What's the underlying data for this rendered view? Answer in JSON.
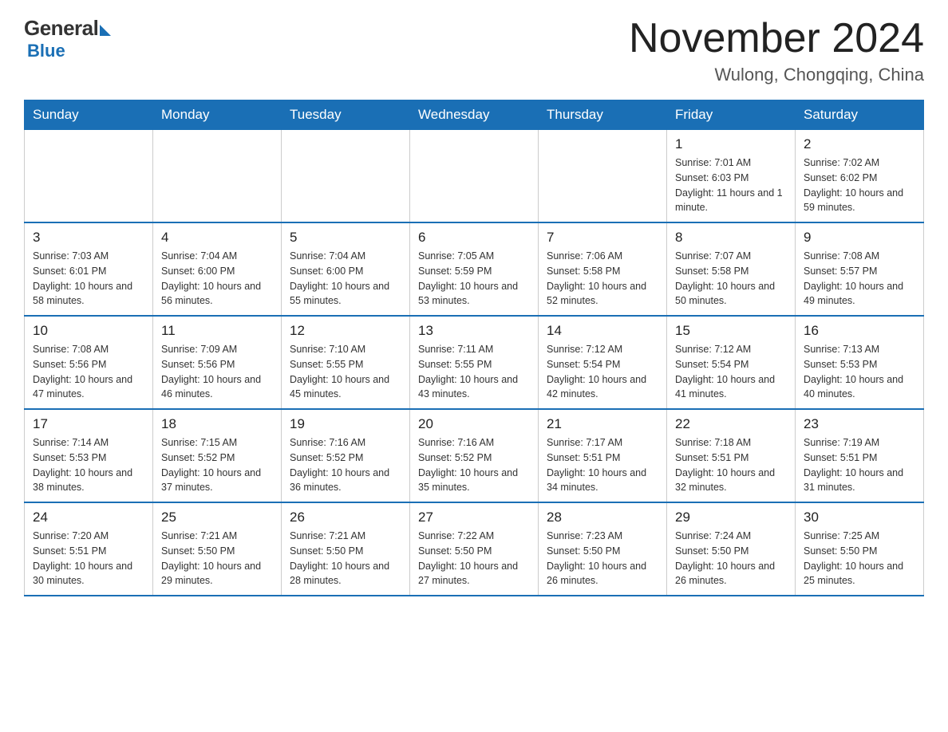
{
  "logo": {
    "general": "General",
    "blue": "Blue",
    "arrow_color": "#1a6fb5"
  },
  "header": {
    "title": "November 2024",
    "subtitle": "Wulong, Chongqing, China"
  },
  "weekdays": [
    "Sunday",
    "Monday",
    "Tuesday",
    "Wednesday",
    "Thursday",
    "Friday",
    "Saturday"
  ],
  "weeks": [
    [
      {
        "day": "",
        "info": ""
      },
      {
        "day": "",
        "info": ""
      },
      {
        "day": "",
        "info": ""
      },
      {
        "day": "",
        "info": ""
      },
      {
        "day": "",
        "info": ""
      },
      {
        "day": "1",
        "info": "Sunrise: 7:01 AM\nSunset: 6:03 PM\nDaylight: 11 hours\nand 1 minute."
      },
      {
        "day": "2",
        "info": "Sunrise: 7:02 AM\nSunset: 6:02 PM\nDaylight: 10 hours\nand 59 minutes."
      }
    ],
    [
      {
        "day": "3",
        "info": "Sunrise: 7:03 AM\nSunset: 6:01 PM\nDaylight: 10 hours\nand 58 minutes."
      },
      {
        "day": "4",
        "info": "Sunrise: 7:04 AM\nSunset: 6:00 PM\nDaylight: 10 hours\nand 56 minutes."
      },
      {
        "day": "5",
        "info": "Sunrise: 7:04 AM\nSunset: 6:00 PM\nDaylight: 10 hours\nand 55 minutes."
      },
      {
        "day": "6",
        "info": "Sunrise: 7:05 AM\nSunset: 5:59 PM\nDaylight: 10 hours\nand 53 minutes."
      },
      {
        "day": "7",
        "info": "Sunrise: 7:06 AM\nSunset: 5:58 PM\nDaylight: 10 hours\nand 52 minutes."
      },
      {
        "day": "8",
        "info": "Sunrise: 7:07 AM\nSunset: 5:58 PM\nDaylight: 10 hours\nand 50 minutes."
      },
      {
        "day": "9",
        "info": "Sunrise: 7:08 AM\nSunset: 5:57 PM\nDaylight: 10 hours\nand 49 minutes."
      }
    ],
    [
      {
        "day": "10",
        "info": "Sunrise: 7:08 AM\nSunset: 5:56 PM\nDaylight: 10 hours\nand 47 minutes."
      },
      {
        "day": "11",
        "info": "Sunrise: 7:09 AM\nSunset: 5:56 PM\nDaylight: 10 hours\nand 46 minutes."
      },
      {
        "day": "12",
        "info": "Sunrise: 7:10 AM\nSunset: 5:55 PM\nDaylight: 10 hours\nand 45 minutes."
      },
      {
        "day": "13",
        "info": "Sunrise: 7:11 AM\nSunset: 5:55 PM\nDaylight: 10 hours\nand 43 minutes."
      },
      {
        "day": "14",
        "info": "Sunrise: 7:12 AM\nSunset: 5:54 PM\nDaylight: 10 hours\nand 42 minutes."
      },
      {
        "day": "15",
        "info": "Sunrise: 7:12 AM\nSunset: 5:54 PM\nDaylight: 10 hours\nand 41 minutes."
      },
      {
        "day": "16",
        "info": "Sunrise: 7:13 AM\nSunset: 5:53 PM\nDaylight: 10 hours\nand 40 minutes."
      }
    ],
    [
      {
        "day": "17",
        "info": "Sunrise: 7:14 AM\nSunset: 5:53 PM\nDaylight: 10 hours\nand 38 minutes."
      },
      {
        "day": "18",
        "info": "Sunrise: 7:15 AM\nSunset: 5:52 PM\nDaylight: 10 hours\nand 37 minutes."
      },
      {
        "day": "19",
        "info": "Sunrise: 7:16 AM\nSunset: 5:52 PM\nDaylight: 10 hours\nand 36 minutes."
      },
      {
        "day": "20",
        "info": "Sunrise: 7:16 AM\nSunset: 5:52 PM\nDaylight: 10 hours\nand 35 minutes."
      },
      {
        "day": "21",
        "info": "Sunrise: 7:17 AM\nSunset: 5:51 PM\nDaylight: 10 hours\nand 34 minutes."
      },
      {
        "day": "22",
        "info": "Sunrise: 7:18 AM\nSunset: 5:51 PM\nDaylight: 10 hours\nand 32 minutes."
      },
      {
        "day": "23",
        "info": "Sunrise: 7:19 AM\nSunset: 5:51 PM\nDaylight: 10 hours\nand 31 minutes."
      }
    ],
    [
      {
        "day": "24",
        "info": "Sunrise: 7:20 AM\nSunset: 5:51 PM\nDaylight: 10 hours\nand 30 minutes."
      },
      {
        "day": "25",
        "info": "Sunrise: 7:21 AM\nSunset: 5:50 PM\nDaylight: 10 hours\nand 29 minutes."
      },
      {
        "day": "26",
        "info": "Sunrise: 7:21 AM\nSunset: 5:50 PM\nDaylight: 10 hours\nand 28 minutes."
      },
      {
        "day": "27",
        "info": "Sunrise: 7:22 AM\nSunset: 5:50 PM\nDaylight: 10 hours\nand 27 minutes."
      },
      {
        "day": "28",
        "info": "Sunrise: 7:23 AM\nSunset: 5:50 PM\nDaylight: 10 hours\nand 26 minutes."
      },
      {
        "day": "29",
        "info": "Sunrise: 7:24 AM\nSunset: 5:50 PM\nDaylight: 10 hours\nand 26 minutes."
      },
      {
        "day": "30",
        "info": "Sunrise: 7:25 AM\nSunset: 5:50 PM\nDaylight: 10 hours\nand 25 minutes."
      }
    ]
  ]
}
